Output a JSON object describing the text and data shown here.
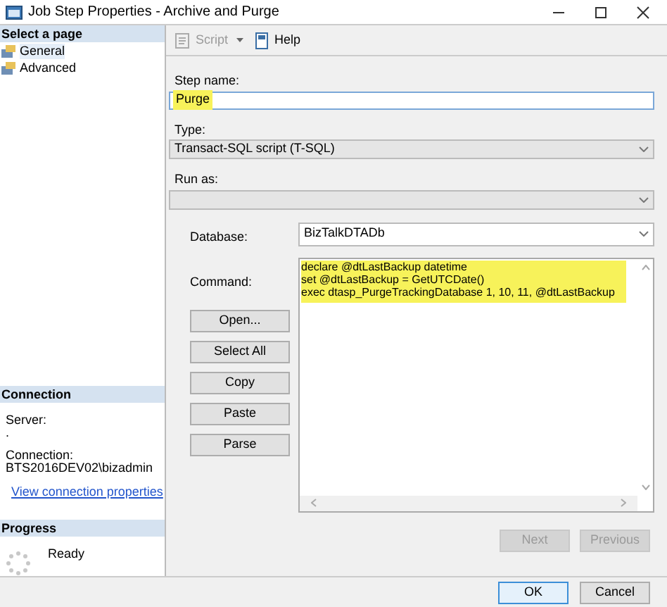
{
  "window": {
    "title": "Job Step Properties - Archive and Purge"
  },
  "sidebar": {
    "header": "Select a page",
    "items": [
      {
        "label": "General",
        "selected": true
      },
      {
        "label": "Advanced",
        "selected": false
      }
    ]
  },
  "connection": {
    "header": "Connection",
    "server_label": "Server:",
    "server": ".",
    "connection_label": "Connection:",
    "connection": "BTS2016DEV02\\bizadmin",
    "link": "View connection properties"
  },
  "progress": {
    "header": "Progress",
    "status": "Ready"
  },
  "toolbar": [
    {
      "label": "Script",
      "disabled": true,
      "dropdown": true
    },
    {
      "label": "Help",
      "disabled": false,
      "dropdown": false
    }
  ],
  "step_name": {
    "label": "Step name:",
    "value": "Purge",
    "highlighted": true
  },
  "type": {
    "label": "Type:",
    "value": "Transact-SQL script (T-SQL)"
  },
  "run_as": {
    "label": "Run as:"
  },
  "database": {
    "label": "Database:",
    "value": "BizTalkDTADb"
  },
  "command": {
    "label": "Command:",
    "lines": [
      "declare @dtLastBackup datetime",
      "set @dtLastBackup = GetUTCDate()",
      "exec dtasp_PurgeTrackingDatabase 1, 10, 11, @dtLastBackup"
    ],
    "highlighted": true
  },
  "command_buttons": [
    "Open...",
    "Select All",
    "Copy",
    "Paste",
    "Parse"
  ],
  "nav_buttons": [
    {
      "label": "Next",
      "disabled": true
    },
    {
      "label": "Previous",
      "disabled": true
    }
  ],
  "buttons": [
    {
      "label": "OK",
      "default": true
    },
    {
      "label": "Cancel",
      "default": false
    }
  ]
}
